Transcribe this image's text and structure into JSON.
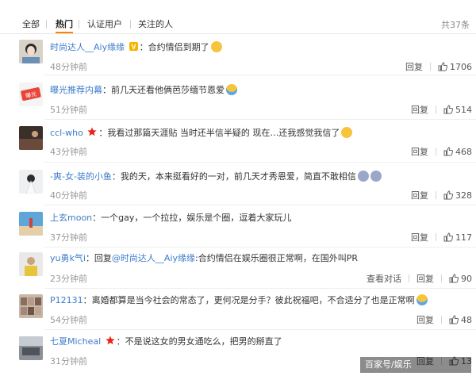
{
  "tabs": {
    "all": "全部",
    "hot": "热门",
    "verified": "认证用户",
    "following": "关注的人",
    "total": "共37条"
  },
  "comments": [
    {
      "user": "时尚达人__Aiy缘缘",
      "badge": "V",
      "colon": "：",
      "text": "合约情侣到期了",
      "emoji": "wink-emoji",
      "time": "48分钟前",
      "reply": "回复",
      "likes": "1706"
    },
    {
      "user": "曝光推荐内幕",
      "colon": "：",
      "text": "前几天还看他俩芭莎缅节恩爱",
      "emoji": "laugh-cry-emoji",
      "time": "51分钟前",
      "reply": "回复",
      "likes": "514"
    },
    {
      "user": "ccl-who",
      "badge": "star",
      "colon": "：",
      "text": "我看过那篇天涯贴 当时还半信半疑的 现在…还我感觉我信了",
      "emoji": "grin-emoji",
      "time": "43分钟前",
      "reply": "回复",
      "likes": "468"
    },
    {
      "user": "-爽-女-装的小鱼",
      "colon": "：",
      "text": "我的天，本来挺看好的一对，前几天才秀恩爱，简直不敢相信",
      "emoji": "cry-emoji",
      "time": "40分钟前",
      "reply": "回复",
      "likes": "328"
    },
    {
      "user": "上玄moon",
      "colon": "：",
      "text": "一个gay，一个拉拉，娱乐是个圈，逗着大家玩儿",
      "time": "37分钟前",
      "reply": "回复",
      "likes": "117"
    },
    {
      "user": "yu勇k气i",
      "colon": "：",
      "reply_prefix": "回复",
      "mention": "@时尚达人__Aiy缘缘",
      "text": ":合约情侣在娱乐圈很正常啊，在国外叫PR",
      "time": "23分钟前",
      "view_dialog": "查看对话",
      "reply": "回复",
      "likes": "90"
    },
    {
      "user": "P12131",
      "colon": "：",
      "text": "离婚都算是当今社会的常态了，更何况是分手？彼此祝福吧，不合适分了也是正常啊",
      "emoji": "laugh-cry-emoji",
      "time": "54分钟前",
      "reply": "回复",
      "likes": "48"
    },
    {
      "user": "七夏Micheal",
      "badge": "star",
      "colon": "：",
      "text": "不是说这女的男女通吃么，把男的掰直了",
      "time": "31分钟前",
      "reply": "回复",
      "likes": "13"
    }
  ],
  "watermark": "百家号/娱乐"
}
